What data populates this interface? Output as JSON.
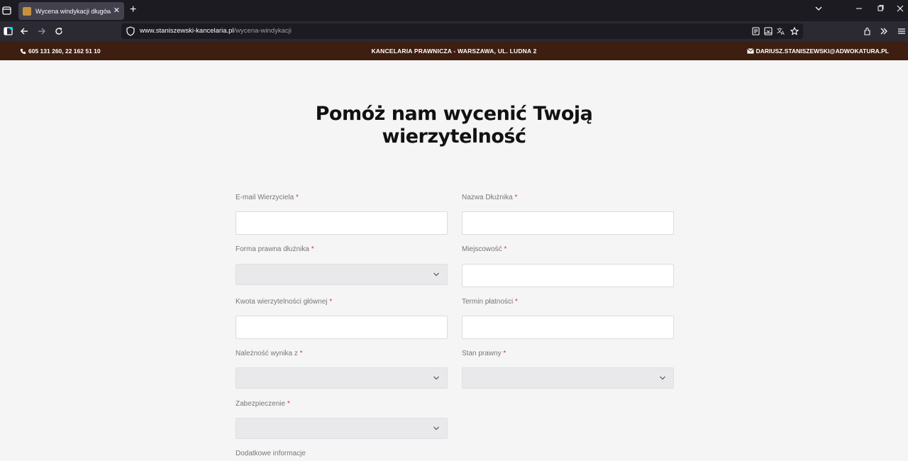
{
  "browser": {
    "tab_title": "Wycena windykacji długów prz",
    "url_host": "www.staniszewski-kancelaria.pl",
    "url_path": "/wycena-windykacji"
  },
  "topstrip": {
    "phone": "605 131 260, 22 162 51 10",
    "center": "KANCELARIA PRAWNICZA - WARSZAWA, UL. LUDNA 2",
    "email": "DARIUSZ.STANISZEWSKI@ADWOKATURA.PL"
  },
  "page": {
    "heading_line1": "Pomóż nam wycenić Twoją",
    "heading_line2": "wierzytelność"
  },
  "form": {
    "required_mark": "*",
    "fields": {
      "email": "E-mail Wierzyciela",
      "debtor_name": "Nazwa Dłużnika",
      "legal_form": "Forma prawna dłużnika",
      "city": "Miejscowość",
      "amount": "Kwota wierzytelności głównej",
      "due_date": "Termin płatności",
      "claim_source": "Należność wynika z",
      "legal_status": "Stan prawny",
      "security": "Zabezpieczenie",
      "additional": "Dodatkowe informacje"
    }
  }
}
